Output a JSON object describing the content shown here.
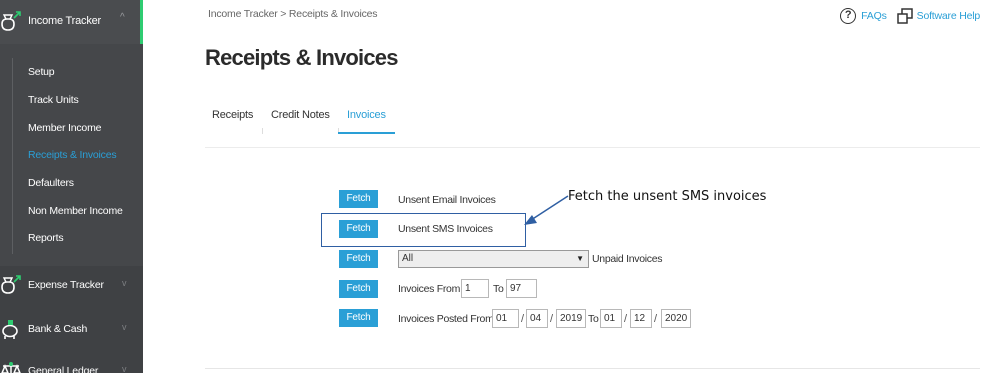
{
  "sidebar": {
    "header": {
      "label": "Income Tracker"
    },
    "items": [
      {
        "label": "Setup"
      },
      {
        "label": "Track Units"
      },
      {
        "label": "Member Income"
      },
      {
        "label": "Receipts & Invoices",
        "active": true
      },
      {
        "label": "Defaulters"
      },
      {
        "label": "Non Member Income"
      },
      {
        "label": "Reports"
      }
    ],
    "groups": [
      {
        "label": "Expense Tracker"
      },
      {
        "label": "Bank & Cash"
      },
      {
        "label": "General Ledger"
      }
    ]
  },
  "header": {
    "breadcrumb": "Income Tracker > Receipts & Invoices",
    "faqs": "FAQs",
    "software_help": "Software Help",
    "title": "Receipts & Invoices"
  },
  "tabs": [
    {
      "label": "Receipts"
    },
    {
      "label": "Credit Notes"
    },
    {
      "label": "Invoices",
      "active": true
    }
  ],
  "rows": {
    "fetch_label": "Fetch",
    "unsent_email": "Unsent Email Invoices",
    "unsent_sms": "Unsent SMS Invoices",
    "unpaid_select_value": "All",
    "unpaid_label": "Unpaid Invoices",
    "invoices_from_label": "Invoices From",
    "invoices_from_value": "1",
    "to_label": "To",
    "to_value": "97",
    "posted_from_label": "Invoices Posted From",
    "posted_from_day": "01",
    "posted_from_month": "04",
    "posted_from_year": "2019",
    "posted_to_label": "To",
    "posted_to_day": "01",
    "posted_to_month": "12",
    "posted_to_year": "2020",
    "slash": "/"
  },
  "annotation": {
    "callout": "Fetch  the unsent SMS invoices"
  },
  "colors": {
    "accent": "#2a9fd6",
    "sidebar_bg": "#3f4144",
    "active_border": "#2ecc71",
    "highlight_box": "#2f5fa3"
  }
}
